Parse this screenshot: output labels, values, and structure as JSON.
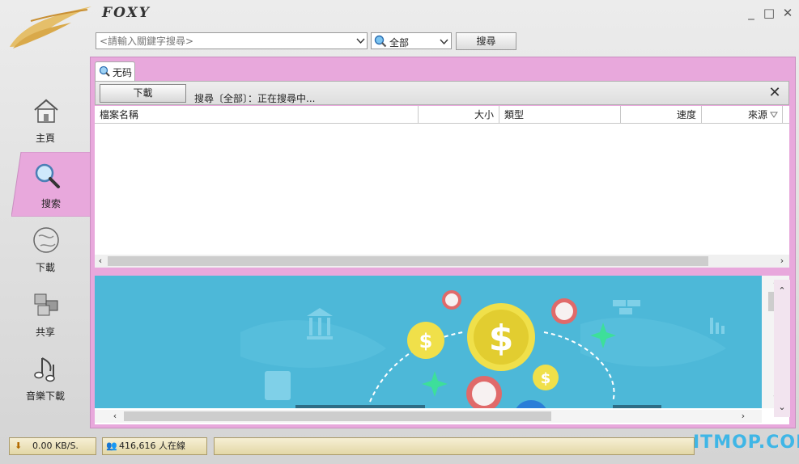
{
  "app": {
    "brand": "FOXY"
  },
  "window": {
    "minimize": "_",
    "maximize": "□",
    "close": "✕"
  },
  "search": {
    "placeholder": "<請輸入關鍵字搜尋>",
    "scope": "全部",
    "button": "搜尋"
  },
  "nav": {
    "items": [
      {
        "label": "主頁",
        "icon": "home-icon"
      },
      {
        "label": "搜索",
        "icon": "search-icon",
        "active": true
      },
      {
        "label": "下載",
        "icon": "download-globe-icon"
      },
      {
        "label": "共享",
        "icon": "share-icon"
      },
      {
        "label": "音樂下載",
        "icon": "music-note-icon"
      }
    ]
  },
  "tab": {
    "label": "无码"
  },
  "toolbar": {
    "download_button": "下載",
    "status": "搜尋〔全部〕：正在搜尋中..."
  },
  "grid": {
    "columns": [
      "檔案名稱",
      "大小",
      "類型",
      "速度",
      "來源"
    ]
  },
  "statusbar": {
    "speed": "0.00 KB/S.",
    "online": "416,616 人在線"
  },
  "watermark": "ITMOP.COM",
  "colors": {
    "frame_pink": "#e8a8dc",
    "banner_blue": "#4db8d8",
    "coin_yellow": "#e9d74a",
    "badge_red": "#e06a6a"
  }
}
